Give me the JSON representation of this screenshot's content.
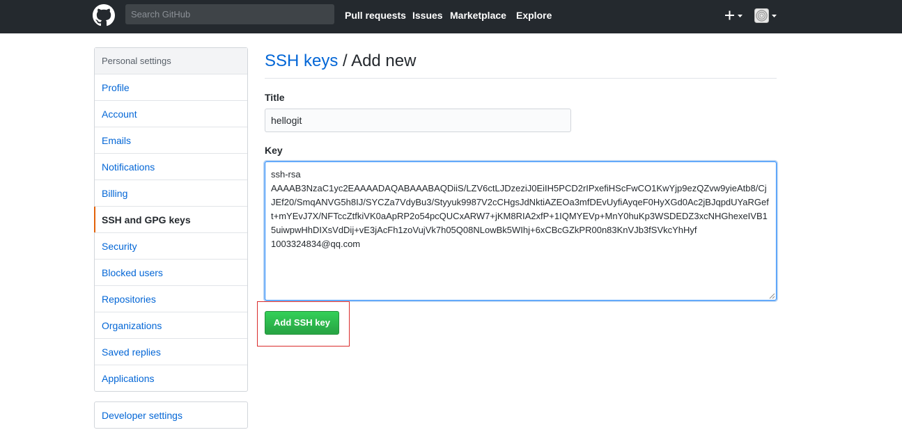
{
  "header": {
    "search_placeholder": "Search GitHub",
    "nav": [
      "Pull requests",
      "Issues",
      "Marketplace",
      "Explore"
    ],
    "icons": [
      "github-logo-icon",
      "plus-icon",
      "caret-down-icon",
      "avatar"
    ]
  },
  "sidebar": {
    "heading": "Personal settings",
    "items": [
      {
        "label": "Profile"
      },
      {
        "label": "Account"
      },
      {
        "label": "Emails"
      },
      {
        "label": "Notifications"
      },
      {
        "label": "Billing"
      },
      {
        "label": "SSH and GPG keys",
        "selected": true
      },
      {
        "label": "Security"
      },
      {
        "label": "Blocked users"
      },
      {
        "label": "Repositories"
      },
      {
        "label": "Organizations"
      },
      {
        "label": "Saved replies"
      },
      {
        "label": "Applications"
      }
    ],
    "developer": "Developer settings"
  },
  "main": {
    "breadcrumb": "SSH keys",
    "separator": "/",
    "title": "Add new",
    "title_label": "Title",
    "title_value": "hellogit",
    "key_label": "Key",
    "key_value": "ssh-rsa\nAAAAB3NzaC1yc2EAAAADAQABAAABAQDiiS/LZV6ctLJDzeziJ0EiIH5PCD2rIPxefiHScFwCO1KwYjp9ezQZvw9yieAtb8/CjJEf20/SmqANVG5h8IJ/SYCZa7VdyBu3/Styyuk9987V2cCHgsJdNktiAZEOa3mfDEvUyfiAyqeF0HyXGd0Ac2jBJqpdUYaRGeft+mYEvJ7X/NFTccZtfkiVK0aApRP2o54pcQUCxARW7+jKM8RIA2xfP+1IQMYEVp+MnY0huKp3WSDEDZ3xcNHGhexeIVB15uiwpwHhDIXsVdDij+vE3jAcFh1zoVujVk7h05Q08NLowBk5WIhj+6xCBcGZkPR00n83KnVJb3fSVkcYhHyf\n1003324834@qq.com",
    "submit_label": "Add SSH key"
  },
  "colors": {
    "header_bg": "#24292e",
    "link": "#0366d6",
    "selected_marker": "#e36209",
    "button_green": "#28a745",
    "highlight_red": "#d92b2b"
  }
}
